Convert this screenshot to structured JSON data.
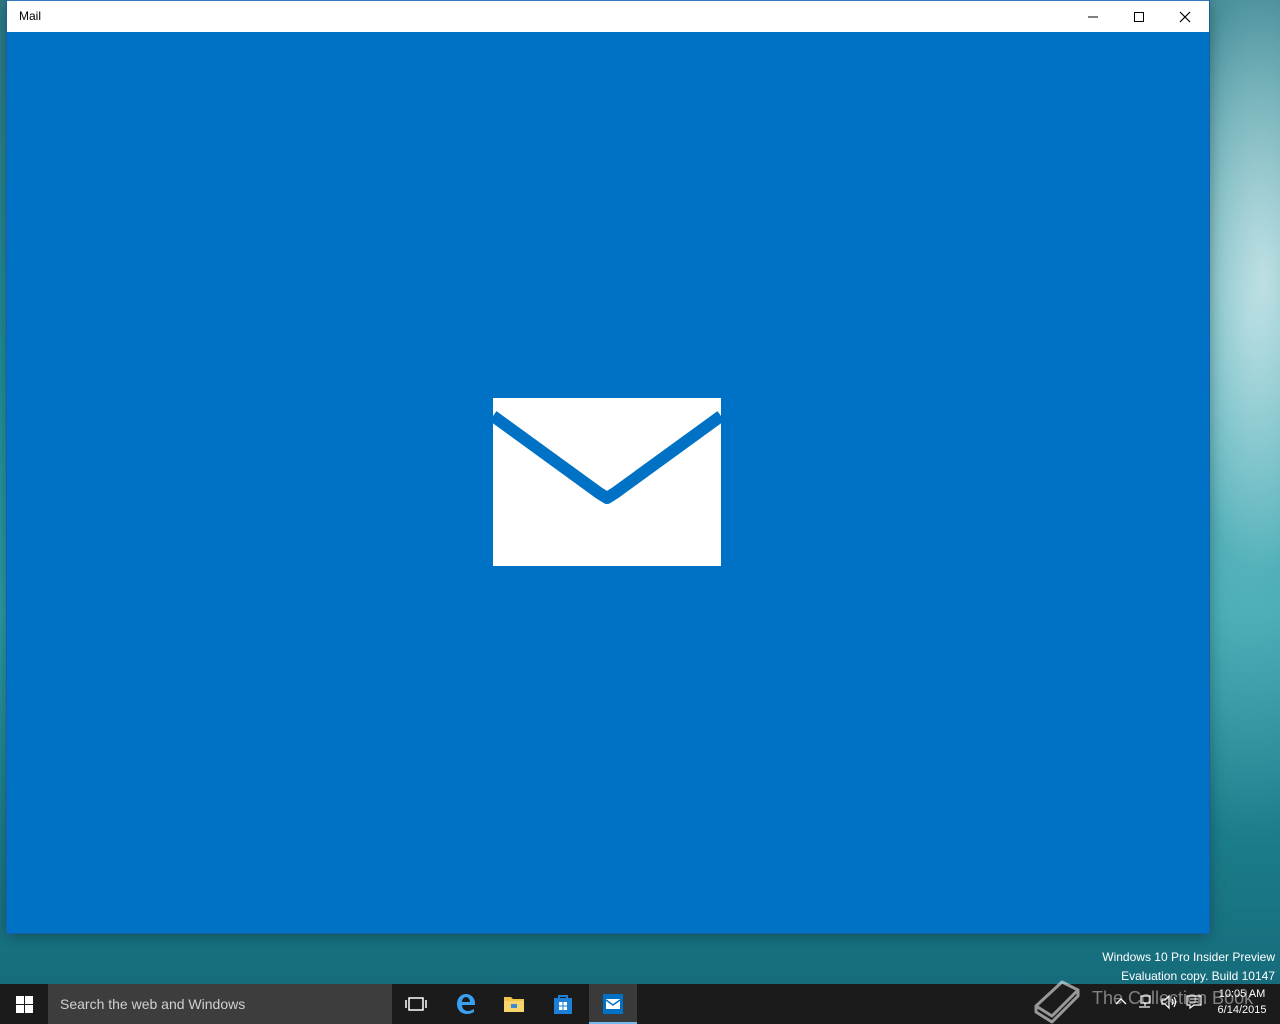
{
  "window": {
    "title": "Mail",
    "accent_color": "#0072c6",
    "controls": {
      "minimize": "minimize-icon",
      "maximize": "maximize-icon",
      "close": "close-icon"
    },
    "splash_icon": "mail-envelope-icon"
  },
  "desktop": {
    "watermark_line1": "Windows 10 Pro Insider Preview",
    "watermark_line2": "Evaluation copy. Build 10147"
  },
  "taskbar": {
    "search_placeholder": "Search the web and Windows",
    "pinned": [
      {
        "name": "task-view",
        "icon": "task-view-icon"
      },
      {
        "name": "edge",
        "icon": "edge-icon"
      },
      {
        "name": "file-explorer",
        "icon": "folder-icon"
      },
      {
        "name": "store",
        "icon": "store-icon"
      },
      {
        "name": "mail",
        "icon": "mail-icon",
        "active": true
      }
    ],
    "tray": {
      "brand_text": "The Collection Book",
      "time": "10:05 AM",
      "date": "6/14/2015"
    }
  }
}
